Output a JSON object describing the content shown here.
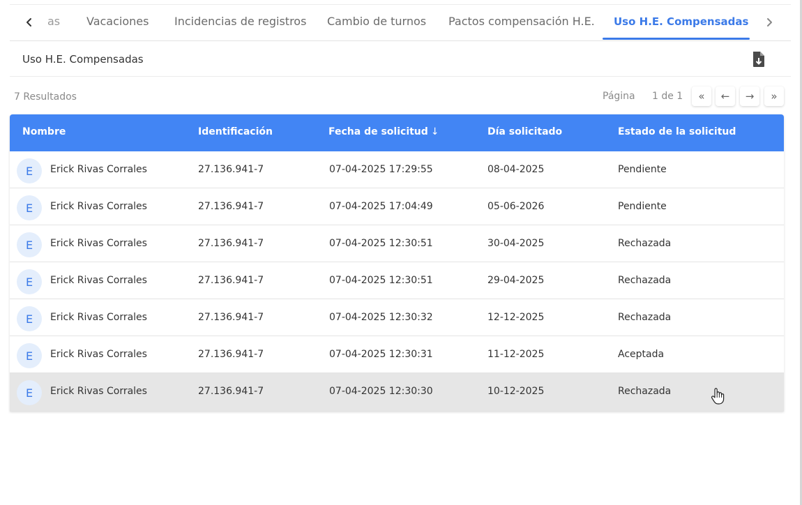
{
  "tabs": {
    "items": [
      {
        "label": "as"
      },
      {
        "label": "Vacaciones"
      },
      {
        "label": "Incidencias de registros"
      },
      {
        "label": "Cambio de turnos"
      },
      {
        "label": "Pactos compensación H.E."
      },
      {
        "label": "Uso H.E. Compensadas"
      }
    ],
    "active": "Uso H.E. Compensadas"
  },
  "section": {
    "title": "Uso H.E. Compensadas",
    "export_icon": "file-download-icon"
  },
  "results": {
    "count_text": "7 Resultados"
  },
  "pagination": {
    "page_label": "Página",
    "page_value": "1 de 1",
    "first_label": "«",
    "prev_label": "←",
    "next_label": "→",
    "last_label": "»"
  },
  "table": {
    "headers": {
      "nombre": "Nombre",
      "identificacion": "Identificación",
      "fecha": "Fecha de solicitud",
      "dia": "Día solicitado",
      "estado": "Estado de la solicitud"
    },
    "sort_icon": "arrow-down-icon",
    "rows": [
      {
        "initial": "E",
        "nombre": "Erick Rivas Corrales",
        "id": "27.136.941-7",
        "fecha": "07-04-2025 17:29:55",
        "dia": "08-04-2025",
        "estado": "Pendiente"
      },
      {
        "initial": "E",
        "nombre": "Erick Rivas Corrales",
        "id": "27.136.941-7",
        "fecha": "07-04-2025 17:04:49",
        "dia": "05-06-2026",
        "estado": "Pendiente"
      },
      {
        "initial": "E",
        "nombre": "Erick Rivas Corrales",
        "id": "27.136.941-7",
        "fecha": "07-04-2025 12:30:51",
        "dia": "30-04-2025",
        "estado": "Rechazada"
      },
      {
        "initial": "E",
        "nombre": "Erick Rivas Corrales",
        "id": "27.136.941-7",
        "fecha": "07-04-2025 12:30:51",
        "dia": "29-04-2025",
        "estado": "Rechazada"
      },
      {
        "initial": "E",
        "nombre": "Erick Rivas Corrales",
        "id": "27.136.941-7",
        "fecha": "07-04-2025 12:30:32",
        "dia": "12-12-2025",
        "estado": "Rechazada"
      },
      {
        "initial": "E",
        "nombre": "Erick Rivas Corrales",
        "id": "27.136.941-7",
        "fecha": "07-04-2025 12:30:31",
        "dia": "11-12-2025",
        "estado": "Aceptada"
      },
      {
        "initial": "E",
        "nombre": "Erick Rivas Corrales",
        "id": "27.136.941-7",
        "fecha": "07-04-2025 12:30:30",
        "dia": "10-12-2025",
        "estado": "Rechazada"
      }
    ]
  },
  "colors": {
    "accent": "#3b7ae8",
    "header_bg": "#4285f4",
    "avatar_bg": "#e4eefc"
  }
}
